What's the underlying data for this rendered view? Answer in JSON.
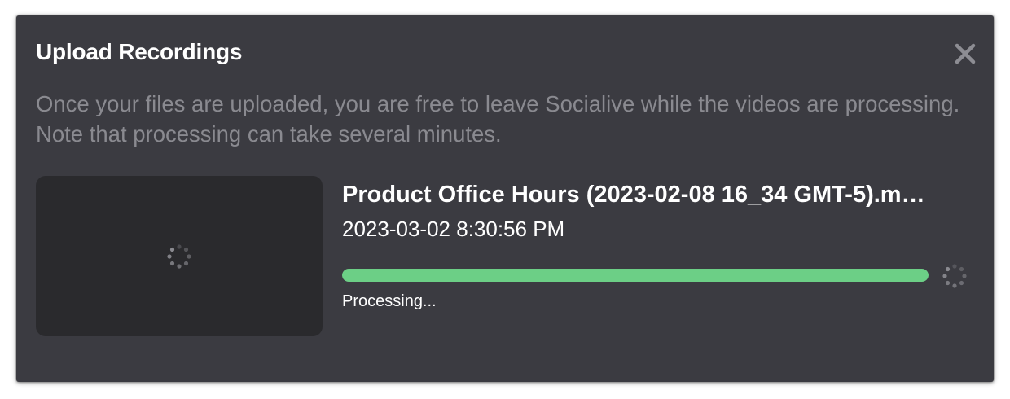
{
  "dialog": {
    "title": "Upload Recordings",
    "close_icon": "close-icon",
    "description": "Once your files are uploaded, you are free to leave Socialive while the videos are processing. Note that processing can take several minutes."
  },
  "upload": {
    "thumbnail_icon": "loading-spinner-icon",
    "file_name": "Product Office Hours (2023-02-08 16_34 GMT-5).m…",
    "timestamp": "2023-03-02 8:30:56 PM",
    "progress_percent": 100,
    "status": "Processing...",
    "status_icon": "loading-spinner-icon"
  },
  "colors": {
    "modal_background": "#3b3b41",
    "thumbnail_background": "#2a2a2d",
    "progress_fill": "#6ccf86",
    "description_text": "#8a8a90"
  }
}
